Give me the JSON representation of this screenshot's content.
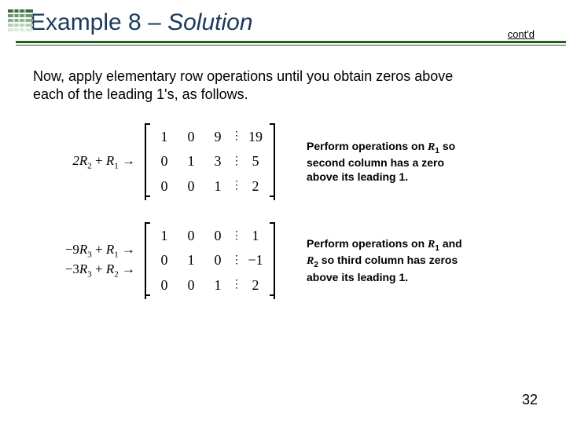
{
  "header": {
    "title_prefix": "Example 8 – ",
    "title_solution": "Solution",
    "contd": "cont'd"
  },
  "para": "Now, apply elementary row operations until you obtain zeros above each of the leading 1's, as follows.",
  "block1": {
    "rowop1": "2R₂ + R₁ →",
    "matrix": {
      "r1": [
        "1",
        "0",
        "9",
        "19"
      ],
      "r2": [
        "0",
        "1",
        "3",
        "5"
      ],
      "r3": [
        "0",
        "0",
        "1",
        "2"
      ]
    },
    "caption_a": "Perform operations on ",
    "caption_r1": "R",
    "caption_s1": "1",
    "caption_b": " so second column has a zero above its leading 1."
  },
  "block2": {
    "rowop1": "−9R₃ + R₁ →",
    "rowop2": "−3R₃ + R₂ →",
    "matrix": {
      "r1": [
        "1",
        "0",
        "0",
        "1"
      ],
      "r2": [
        "0",
        "1",
        "0",
        "−1"
      ],
      "r3": [
        "0",
        "0",
        "1",
        "2"
      ]
    },
    "caption_a": "Perform operations on ",
    "caption_r1": "R",
    "caption_s1": "1",
    "caption_b": " and ",
    "caption_r2": "R",
    "caption_s2": "2",
    "caption_c": " so third column has zeros above its leading 1."
  },
  "pagenum": "32"
}
